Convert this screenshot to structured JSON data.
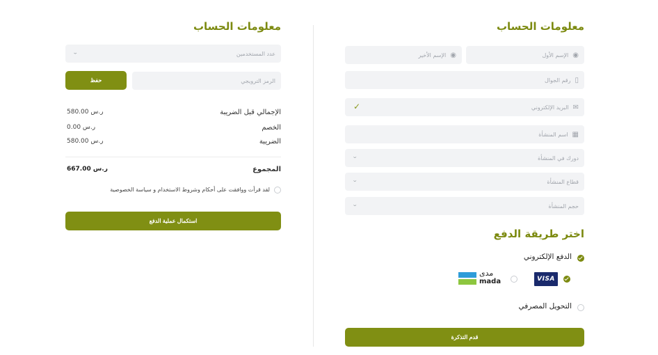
{
  "right_panel": {
    "title": "معلومات الحساب",
    "first_name_placeholder": "الإسم الأول",
    "last_name_placeholder": "الإسم الأخير",
    "mobile_placeholder": "رقم الجوال",
    "email_placeholder": "البريد الإلكتروني",
    "company_placeholder": "اسم المنشأة",
    "role_placeholder": "دورك في المنشأة",
    "sector_placeholder": "قطاع المنشأة",
    "size_placeholder": "حجم المنشأة",
    "payment_title": "اختر طريقة الدفع",
    "payment_options": {
      "electronic": "الدفع الإلكتروني",
      "bank_transfer": "التحويل المصرفي"
    },
    "visa_label": "VISA",
    "mada_label_ar": "مدى",
    "mada_label_en": "mada",
    "submit_label": "قدم التذكرة"
  },
  "left_panel": {
    "title": "معلومات الحساب",
    "users_placeholder": "عدد المستخدمين",
    "promo_placeholder": "الرمز الترويجي",
    "save_label": "حفظ",
    "summary": {
      "subtotal_label": "الإجمالي قبل الضريبة",
      "subtotal_value": "580.00 ر.س",
      "discount_label": "الخصم",
      "discount_value": "0.00 ر.س",
      "tax_label": "الضريبة",
      "tax_value": "580.00 ر.س",
      "total_label": "المجموع",
      "total_value": "667.00 ر.س"
    },
    "terms_text": "لقد قرأت ووافقت على أحكام وشروط الاستخدام و سياسة الخصوصية",
    "checkout_label": "استكمال عملية الدفع"
  },
  "colors": {
    "accent": "#808f13",
    "field_bg": "#f2f3f5"
  }
}
